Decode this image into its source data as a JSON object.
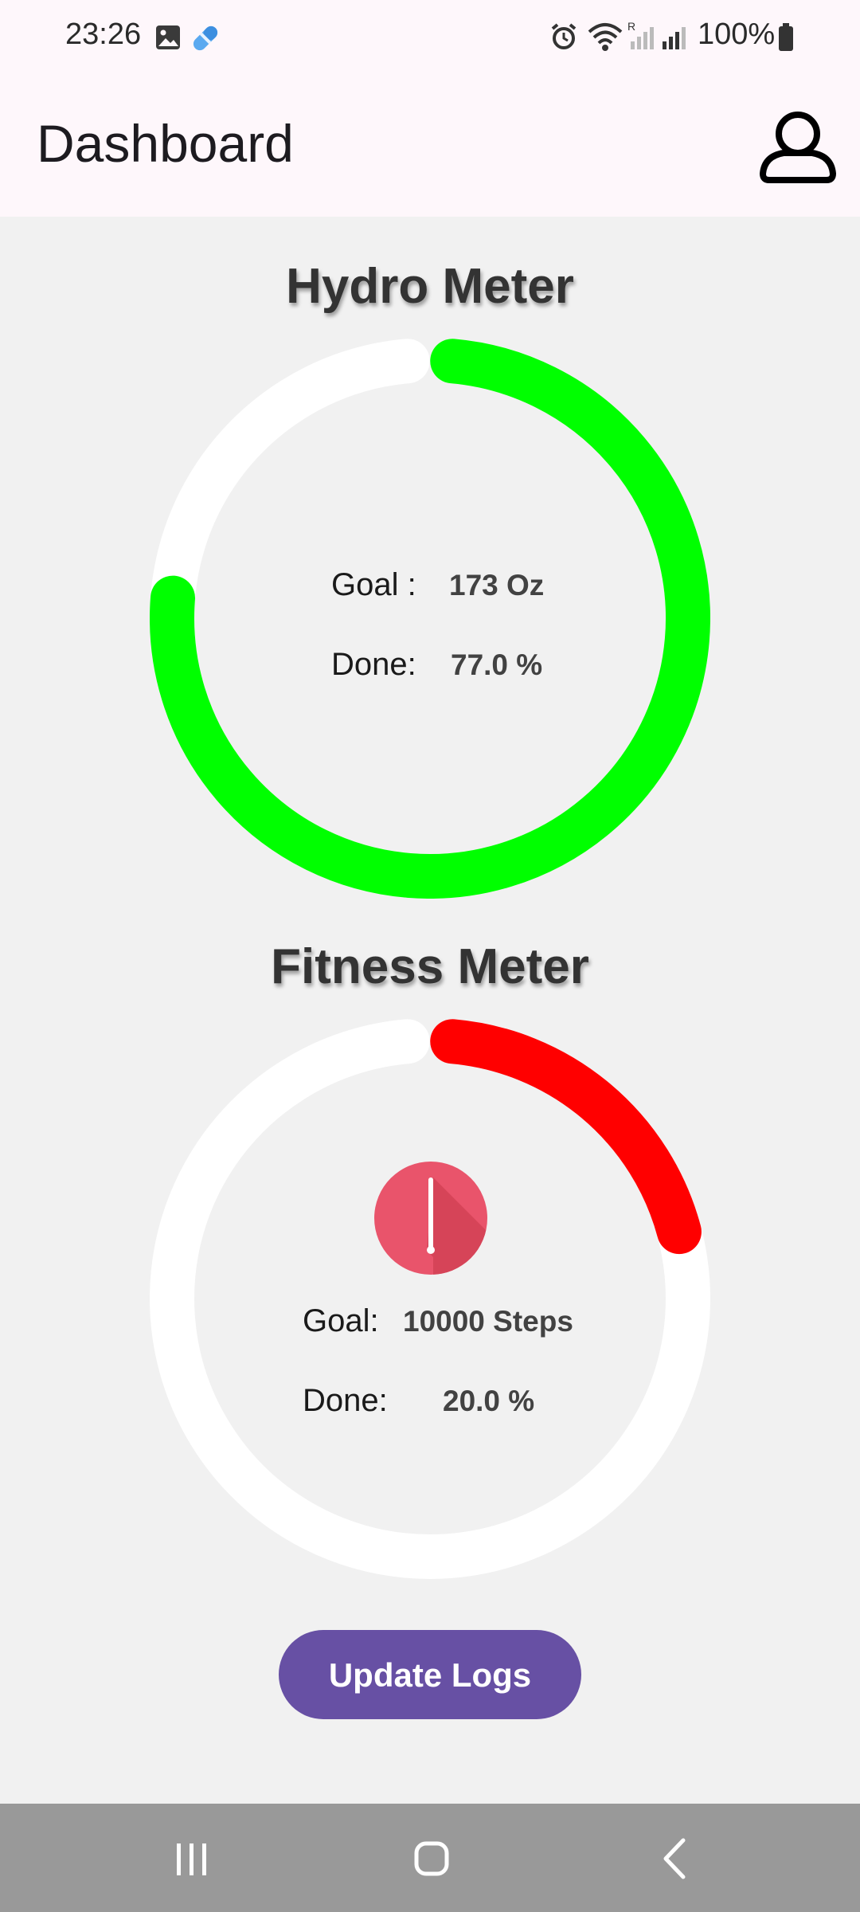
{
  "status_bar": {
    "time": "23:26",
    "battery": "100%",
    "icons": [
      "gallery-icon",
      "pill-icon",
      "alarm-icon",
      "wifi-icon",
      "signal-roaming-icon",
      "signal-icon",
      "battery-icon"
    ]
  },
  "app_bar": {
    "title": "Dashboard",
    "profile_icon": "person-outline-icon"
  },
  "hydro": {
    "title": "Hydro Meter",
    "goal_label": "Goal :",
    "goal_value": "173 Oz",
    "done_label": "Done:",
    "done_value": "77.0 %",
    "progress": 0.77,
    "color": "#00ff00"
  },
  "fitness": {
    "title": "Fitness Meter",
    "goal_label": "Goal:",
    "goal_value": "10000 Steps",
    "done_label": "Done:",
    "done_value": "20.0 %",
    "progress": 0.2,
    "color": "#ff0000",
    "alert_icon": "exclamation-alert-icon",
    "alert_color": "#e9546b"
  },
  "track_color": "#ffffff",
  "update_button": {
    "label": "Update Logs",
    "color": "#6750a4"
  },
  "nav_bar": {
    "icons": [
      "recents-icon",
      "home-icon",
      "back-icon"
    ]
  }
}
